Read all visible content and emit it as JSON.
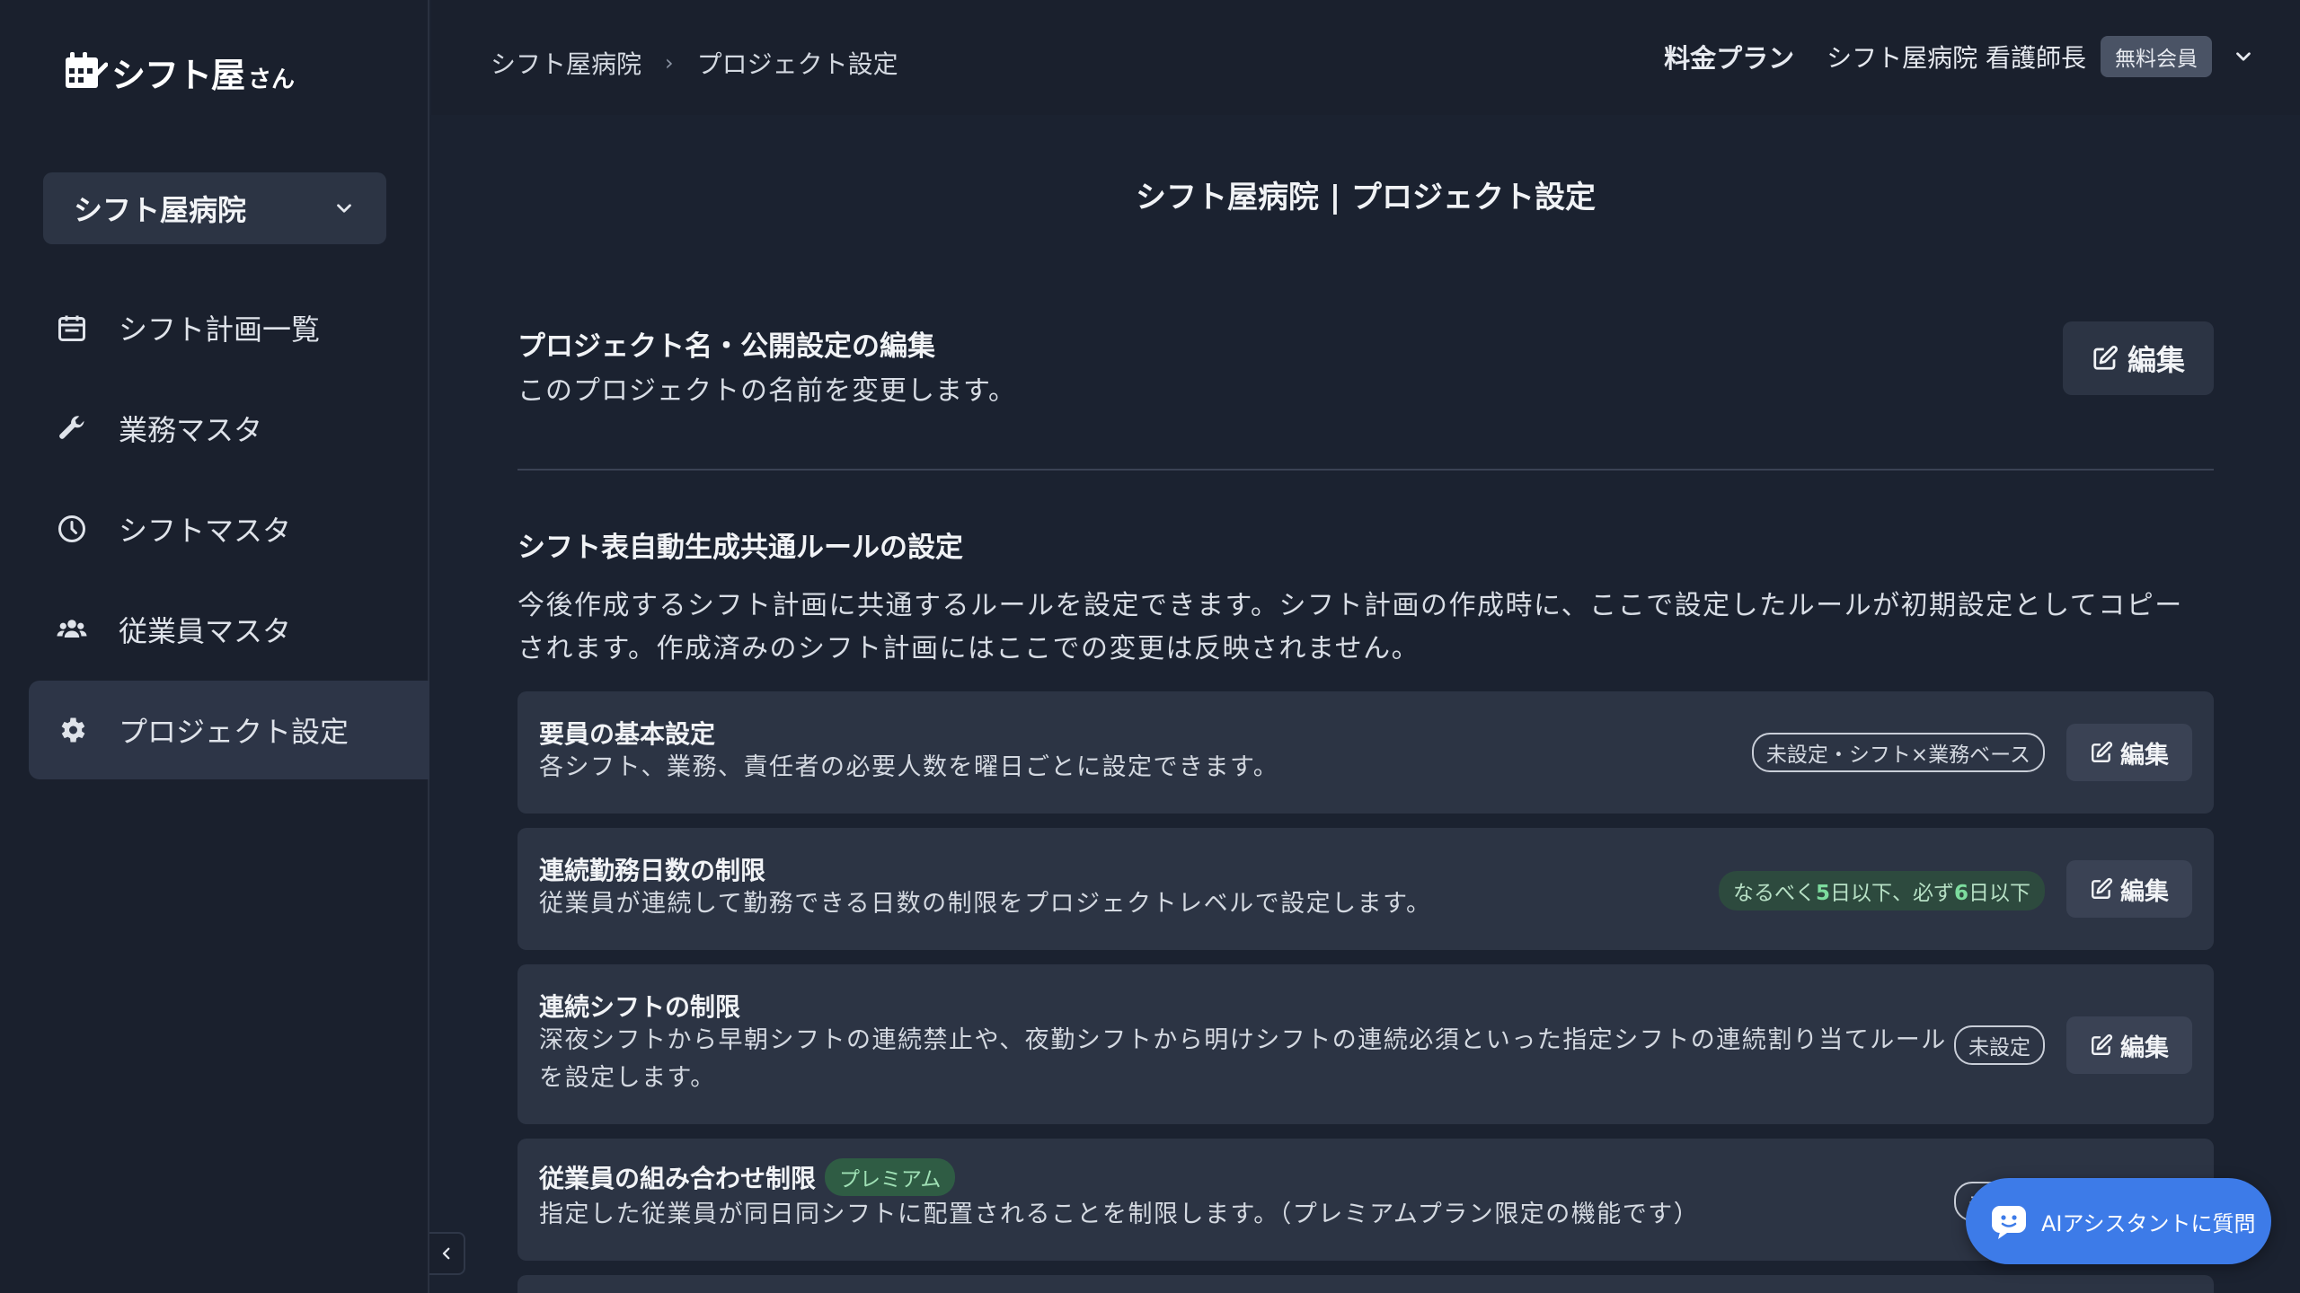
{
  "app": {
    "logo_main": "シフト屋",
    "logo_sub": "さん"
  },
  "sidebar": {
    "org_name": "シフト屋病院",
    "items": [
      {
        "label": "シフト計画一覧",
        "icon": "calendar-icon"
      },
      {
        "label": "業務マスタ",
        "icon": "wrench-icon"
      },
      {
        "label": "シフトマスタ",
        "icon": "clock-icon"
      },
      {
        "label": "従業員マスタ",
        "icon": "users-icon"
      },
      {
        "label": "プロジェクト設定",
        "icon": "gear-icon",
        "active": true
      }
    ]
  },
  "header": {
    "breadcrumb": [
      "シフト屋病院",
      "プロジェクト設定"
    ],
    "breadcrumb_sep": "›",
    "plan_link": "料金プラン",
    "user_name": "シフト屋病院 看護師長",
    "user_badge": "無料会員"
  },
  "main": {
    "title": "シフト屋病院 | プロジェクト設定",
    "section1": {
      "heading": "プロジェクト名・公開設定の編集",
      "description": "このプロジェクトの名前を変更します。",
      "edit_label": "編集"
    },
    "section2": {
      "heading": "シフト表自動生成共通ルールの設定",
      "description_line1": "今後作成するシフト計画に共通するルールを設定できます。シフト計画の作成時に、ここで設定したルールが初期設定としてコピー",
      "description_line2": "されます。作成済みのシフト計画にはここでの変更は反映されません。"
    },
    "cards": [
      {
        "title": "要員の基本設定",
        "description": "各シフト、業務、責任者の必要人数を曜日ごとに設定できます。",
        "status": "未設定・シフト×業務ベース",
        "edit_label": "編集"
      },
      {
        "title": "連続勤務日数の制限",
        "description": "従業員が連続して勤務できる日数の制限をプロジェクトレベルで設定します。",
        "status_prefix": "なるべく",
        "status_num1": "5",
        "status_mid": "日以下、必ず",
        "status_num2": "6",
        "status_suffix": "日以下",
        "edit_label": "編集"
      },
      {
        "title": "連続シフトの制限",
        "description_line1": "深夜シフトから早朝シフトの連続禁止や、夜勤シフトから明けシフトの連続必須といった指定シフトの連続割り当てルール",
        "description_line2": "を設定します。",
        "status": "未設定",
        "edit_label": "編集"
      },
      {
        "title": "従業員の組み合わせ制限",
        "premium_badge": "プレミアム",
        "description": "指定した従業員が同日同シフトに配置されることを制限します。（プレミアムプラン限定の機能です）",
        "status": "未設定"
      }
    ]
  },
  "assistant": {
    "label": "AIアシスタントに質問"
  },
  "colors": {
    "background": "#1b2230",
    "card": "#2c3444",
    "accent_blue": "#3d7be8",
    "green_tag": "#2d4a3e"
  }
}
